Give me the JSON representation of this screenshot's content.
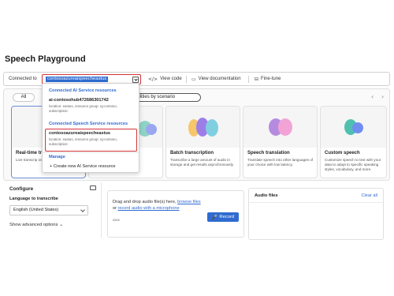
{
  "page_title": "Speech Playground",
  "toolbar": {
    "connected_label": "Connected to",
    "selected_resource": "contosoazureaispeecheastus",
    "view_code_icon": "code-icon",
    "view_code": "View code",
    "view_docs_icon": "document-icon",
    "view_docs": "View documentation",
    "fine_tune_icon": "tune-icon",
    "fine_tune": "Fine-tune"
  },
  "filters": {
    "all": "All",
    "scenario": "h capabilities by scenario"
  },
  "dropdown": {
    "ai_header": "Connected AI Service resources",
    "ai_item_name": "ai-contosohub472686301742",
    "ai_item_desc": "location: eastus, resource group: rg-contoso, subscription:",
    "speech_header": "Connected Speech Service resources",
    "speech_item_name": "contosoazureaispeecheastus",
    "speech_item_desc": "location: eastus, resource group: rg-contoso, subscription:",
    "manage": "Manage",
    "create": "+ Create new AI Service resource"
  },
  "cards": [
    {
      "title": "Real-time tr",
      "desc": "Live transcrip own audio wit"
    },
    {
      "title": "",
      "desc": ""
    },
    {
      "title": "Batch transcription",
      "desc": "Transcribe a large amount of audio in storage and get results asynchronously."
    },
    {
      "title": "Speech translation",
      "desc": "Translate speech into other languages of your choice with low latency."
    },
    {
      "title": "Custom speech",
      "desc": "Customize speech to text with your data to adapt to specific speaking styles, vocabulary, and more."
    }
  ],
  "configure": {
    "title": "Configure",
    "lang_label": "Language to transcribe",
    "lang_value": "English (United States)",
    "advanced": "Show advanced options"
  },
  "upload": {
    "line1_prefix": "Drag and drop audio file(s) here, ",
    "browse": "browse files",
    "line2_prefix": "or ",
    "record_link": "record audio with a microphone",
    "small": "xxxx",
    "record_btn": "Record"
  },
  "audio_files": {
    "title": "Audio files",
    "clear": "Clear all"
  },
  "colors": {
    "accent": "#2f6bd0",
    "highlight": "#d13438"
  }
}
